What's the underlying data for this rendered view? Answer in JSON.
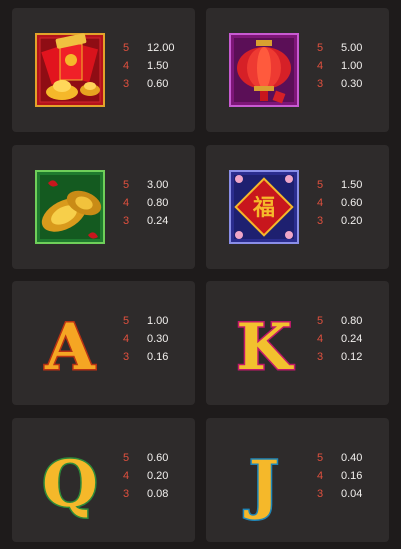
{
  "paytable": [
    {
      "symbol": "red-envelope-gold-icon",
      "pays": [
        {
          "count": "5",
          "value": "12.00"
        },
        {
          "count": "4",
          "value": "1.50"
        },
        {
          "count": "3",
          "value": "0.60"
        }
      ]
    },
    {
      "symbol": "red-lantern-icon",
      "pays": [
        {
          "count": "5",
          "value": "5.00"
        },
        {
          "count": "4",
          "value": "1.00"
        },
        {
          "count": "3",
          "value": "0.30"
        }
      ]
    },
    {
      "symbol": "golden-cymbals-icon",
      "pays": [
        {
          "count": "5",
          "value": "3.00"
        },
        {
          "count": "4",
          "value": "0.80"
        },
        {
          "count": "3",
          "value": "0.24"
        }
      ]
    },
    {
      "symbol": "fu-charm-icon",
      "glyph": "福",
      "pays": [
        {
          "count": "5",
          "value": "1.50"
        },
        {
          "count": "4",
          "value": "0.60"
        },
        {
          "count": "3",
          "value": "0.20"
        }
      ]
    },
    {
      "symbol": "letter-a-icon",
      "glyph": "A",
      "pays": [
        {
          "count": "5",
          "value": "1.00"
        },
        {
          "count": "4",
          "value": "0.30"
        },
        {
          "count": "3",
          "value": "0.16"
        }
      ]
    },
    {
      "symbol": "letter-k-icon",
      "glyph": "K",
      "pays": [
        {
          "count": "5",
          "value": "0.80"
        },
        {
          "count": "4",
          "value": "0.24"
        },
        {
          "count": "3",
          "value": "0.12"
        }
      ]
    },
    {
      "symbol": "letter-q-icon",
      "glyph": "Q",
      "pays": [
        {
          "count": "5",
          "value": "0.60"
        },
        {
          "count": "4",
          "value": "0.20"
        },
        {
          "count": "3",
          "value": "0.08"
        }
      ]
    },
    {
      "symbol": "letter-j-icon",
      "glyph": "J",
      "pays": [
        {
          "count": "5",
          "value": "0.40"
        },
        {
          "count": "4",
          "value": "0.16"
        },
        {
          "count": "3",
          "value": "0.04"
        }
      ]
    }
  ],
  "colors": {
    "background": "#1e1b1b",
    "card": "#2e2b2b",
    "count": "#e0503e",
    "value": "#f2f0ee",
    "gold": "#f5b82a",
    "red": "#c8161d"
  }
}
